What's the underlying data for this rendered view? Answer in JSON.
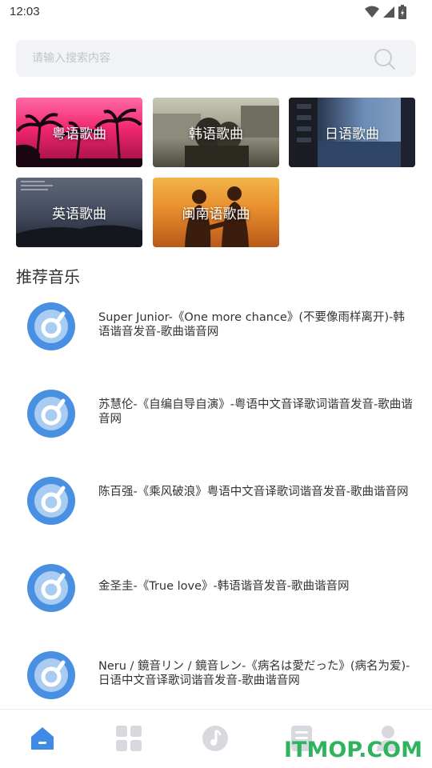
{
  "status_bar": {
    "time": "12:03"
  },
  "search": {
    "placeholder": "请输入搜索内容"
  },
  "categories": [
    {
      "label": "粤语歌曲"
    },
    {
      "label": "韩语歌曲"
    },
    {
      "label": "日语歌曲"
    },
    {
      "label": "英语歌曲"
    },
    {
      "label": "闽南语歌曲"
    }
  ],
  "recommended": {
    "title": "推荐音乐",
    "items": [
      {
        "text": "Super Junior-《One more chance》(不要像雨样离开)-韩语谐音发音-歌曲谐音网"
      },
      {
        "text": "苏慧伦-《自编自导自演》-粤语中文音译歌词谐音发音-歌曲谐音网"
      },
      {
        "text": "陈百强-《乘风破浪》粤语中文音译歌词谐音发音-歌曲谐音网"
      },
      {
        "text": "金圣圭-《True love》-韩语谐音发音-歌曲谐音网"
      },
      {
        "text": "Neru / 鏡音リン / 鏡音レン-《病名は愛だった》(病名为爱)-日语中文音译歌词谐音发音-歌曲谐音网"
      }
    ]
  },
  "bottom_nav": [
    {
      "icon": "home-icon",
      "active": true
    },
    {
      "icon": "grid-icon",
      "active": false
    },
    {
      "icon": "music-icon",
      "active": false
    },
    {
      "icon": "document-icon",
      "active": false
    },
    {
      "icon": "user-icon",
      "active": false
    }
  ],
  "colors": {
    "accent": "#3f8ae6",
    "inactive": "#d7d9de",
    "search_bg": "#f2f3f6"
  },
  "watermark": "ITMOP.COM"
}
